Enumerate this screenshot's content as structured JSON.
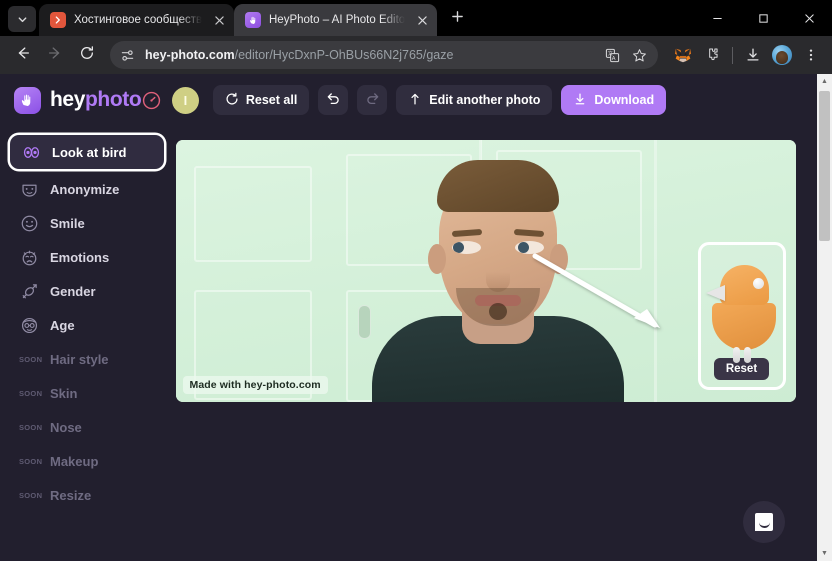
{
  "browser": {
    "tab_search_icon": "chevron-down-icon",
    "new_tab_icon": "plus-icon",
    "tabs": [
      {
        "title": "Хостинговое сообщество «Tim",
        "favicon": "hosting-chevron-favicon",
        "active": false,
        "close_label": "×"
      },
      {
        "title": "HeyPhoto – AI Photo Editor Onl",
        "favicon": "heyphoto-hand-favicon",
        "active": true,
        "close_label": "×"
      }
    ],
    "window_controls": {
      "minimize": "–",
      "maximize": "□",
      "close": "×"
    },
    "nav": {
      "back_icon": "arrow-left-icon",
      "forward_icon": "arrow-right-icon",
      "reload_icon": "reload-icon",
      "site_info_icon": "site-settings-icon"
    },
    "omnibox": {
      "domain": "hey-photo.com",
      "path": "/editor/HycDxnP-OhBUs66N2j765/gaze",
      "translate_icon": "translate-icon",
      "bookmark_icon": "star-icon"
    },
    "extensions": {
      "metamask_icon": "metamask-fox-icon",
      "puzzle_icon": "extensions-puzzle-icon",
      "download_icon": "download-icon",
      "profile_icon": "profile-avatar-icon",
      "menu_icon": "three-dot-menu-icon"
    }
  },
  "app": {
    "logo": {
      "hey": "hey",
      "photo": "photo",
      "mark_icon": "waving-hand-icon"
    },
    "header": {
      "speedometer_icon": "speedometer-icon",
      "avatar_initial": "I",
      "reset_all_label": "Reset all",
      "reset_all_icon": "rotate-ccw-icon",
      "undo_icon": "undo-arrow-icon",
      "redo_icon": "redo-arrow-icon",
      "edit_another_label": "Edit another photo",
      "edit_another_icon": "upload-icon",
      "download_label": "Download",
      "download_icon": "download-arrow-icon"
    },
    "sidebar": {
      "items": [
        {
          "label": "Look at bird",
          "icon": "eyes-icon",
          "active": true,
          "soon": false
        },
        {
          "label": "Anonymize",
          "icon": "mask-icon",
          "active": false,
          "soon": false
        },
        {
          "label": "Smile",
          "icon": "smiley-icon",
          "active": false,
          "soon": false
        },
        {
          "label": "Emotions",
          "icon": "crying-face-icon",
          "active": false,
          "soon": false
        },
        {
          "label": "Gender",
          "icon": "gender-icon",
          "active": false,
          "soon": false
        },
        {
          "label": "Age",
          "icon": "elder-face-icon",
          "active": false,
          "soon": false
        },
        {
          "label": "Hair style",
          "icon": "",
          "active": false,
          "soon": true,
          "badge": "SOON"
        },
        {
          "label": "Skin",
          "icon": "",
          "active": false,
          "soon": true,
          "badge": "SOON"
        },
        {
          "label": "Nose",
          "icon": "",
          "active": false,
          "soon": true,
          "badge": "SOON"
        },
        {
          "label": "Makeup",
          "icon": "",
          "active": false,
          "soon": true,
          "badge": "SOON"
        },
        {
          "label": "Resize",
          "icon": "",
          "active": false,
          "soon": true,
          "badge": "SOON"
        }
      ]
    },
    "canvas": {
      "watermark": "Made with hey-photo.com",
      "arrow_icon": "gaze-direction-arrow-icon",
      "bird_panel": {
        "bird_icon": "orange-bird-icon",
        "reset_label": "Reset"
      },
      "photo_alt": "portrait-photo"
    },
    "chat": {
      "icon": "intercom-chat-icon"
    },
    "colors": {
      "accent": "#b07af5",
      "page_bg": "#221f2e",
      "panel_bg": "#302c40",
      "avatar": "#cfcf84",
      "photo_bg": "#d8f3dd",
      "bird": "#eb9a43"
    }
  }
}
